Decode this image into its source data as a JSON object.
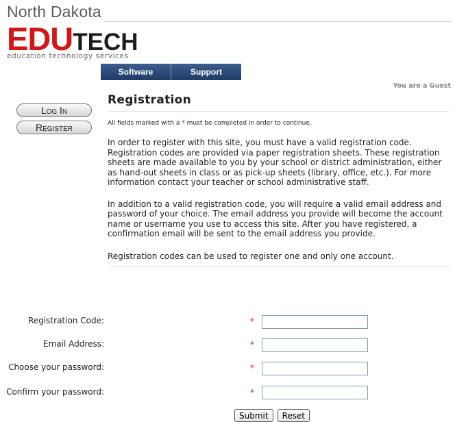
{
  "brand": {
    "top_text": "North Dakota",
    "logo_big": "EDU",
    "logo_small": "TECH",
    "subtitle": "education technology services"
  },
  "nav": {
    "items": [
      {
        "label": "Software"
      },
      {
        "label": "Support"
      }
    ]
  },
  "user_status": "You are a Guest",
  "sidebar": {
    "login_label": "Log In",
    "register_label": "Register"
  },
  "page": {
    "title": "Registration",
    "required_note_before": "All fields marked with a ",
    "required_star": "*",
    "required_note_after": " must be completed in order to continue.",
    "paragraphs": [
      "In order to register with this site, you must have a valid registration code. Registration codes are provided via paper registration sheets. These registration sheets are made available to you by your school or district administration, either as hand-out sheets in class or as pick-up sheets (library, office, etc.). For more information contact your teacher or school administrative staff.",
      "In addition to a valid registration code, you will require a valid email address and password of your choice. The email address you provide will become the account name or username you use to access this site. After you have registered, a confirmation email will be sent to the email address you provide.",
      "Registration codes can be used to register one and only one account."
    ]
  },
  "form": {
    "fields": [
      {
        "label": "Registration Code:",
        "required": "*",
        "value": ""
      },
      {
        "label": "Email Address:",
        "required": "*",
        "value": ""
      },
      {
        "label": "Choose your password:",
        "required": "*",
        "value": ""
      },
      {
        "label": "Confirm your password:",
        "required": "*",
        "value": ""
      }
    ],
    "submit_label": "Submit",
    "reset_label": "Reset"
  },
  "colors": {
    "brand_red": "#d01818",
    "nav_blue": "#1f3b66",
    "required_red": "#e02020"
  }
}
